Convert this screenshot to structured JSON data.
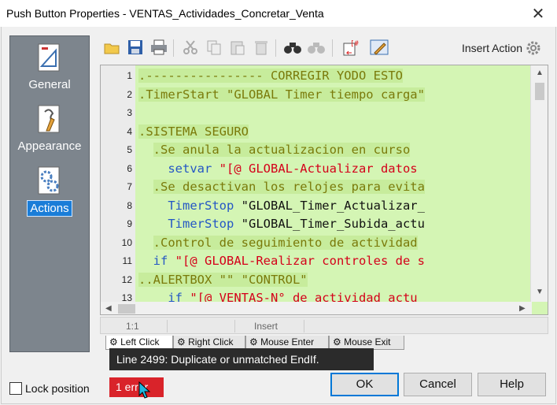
{
  "window": {
    "title": "Push Button Properties - VENTAS_Actividades_Concretar_Venta",
    "close_glyph": "✕"
  },
  "sidebar": {
    "items": [
      {
        "label": "General",
        "icon": "general-icon",
        "active": false
      },
      {
        "label": "Appearance",
        "icon": "appearance-icon",
        "active": false
      },
      {
        "label": "Actions",
        "icon": "actions-icon",
        "active": true
      }
    ]
  },
  "toolbar": {
    "buttons": [
      "new-icon",
      "save-icon",
      "print-icon",
      "cut-icon",
      "copy-icon",
      "paste-icon",
      "delete-icon",
      "find-icon",
      "replace-icon",
      "insert-variable-icon",
      "edit-icon"
    ],
    "insert_action_label": "Insert Action"
  },
  "editor": {
    "lines": [
      {
        "num": "1",
        "indent": "",
        "parts": [
          {
            "t": ".---------------- CORREGIR YODO ESTO",
            "c": "olive"
          }
        ]
      },
      {
        "num": "2",
        "indent": "",
        "parts": [
          {
            "t": ".TimerStart \"GLOBAL Timer tiempo carga\"",
            "c": "olive"
          }
        ]
      },
      {
        "num": "3",
        "indent": "",
        "parts": []
      },
      {
        "num": "4",
        "indent": "",
        "parts": [
          {
            "t": ".SISTEMA SEGURO",
            "c": "olive"
          }
        ]
      },
      {
        "num": "5",
        "indent": "  ",
        "parts": [
          {
            "t": ".Se anula la actualizacion en curso",
            "c": "olive"
          }
        ]
      },
      {
        "num": "6",
        "indent": "    ",
        "parts": [
          {
            "t": "setvar",
            "c": "blue"
          },
          {
            "t": " \"[@ GLOBAL-Actualizar datos",
            "c": "red"
          }
        ]
      },
      {
        "num": "7",
        "indent": "  ",
        "parts": [
          {
            "t": ".Se desactivan los relojes para evita",
            "c": "olive"
          }
        ]
      },
      {
        "num": "8",
        "indent": "    ",
        "parts": [
          {
            "t": "TimerStop",
            "c": "blue"
          },
          {
            "t": " \"GLOBAL_Timer_Actualizar_",
            "c": "black"
          }
        ]
      },
      {
        "num": "9",
        "indent": "    ",
        "parts": [
          {
            "t": "TimerStop",
            "c": "blue"
          },
          {
            "t": " \"GLOBAL_Timer_Subida_actu",
            "c": "black"
          }
        ]
      },
      {
        "num": "10",
        "indent": "  ",
        "parts": [
          {
            "t": ".Control de seguimiento de actividad",
            "c": "olive"
          }
        ]
      },
      {
        "num": "11",
        "indent": "  ",
        "parts": [
          {
            "t": "if",
            "c": "blue"
          },
          {
            "t": " \"[@ GLOBAL-Realizar controles de s",
            "c": "red"
          }
        ]
      },
      {
        "num": "12",
        "indent": "",
        "parts": [
          {
            "t": "..ALERTBOX \"\" \"CONTROL\"",
            "c": "olive"
          }
        ]
      },
      {
        "num": "13",
        "indent": "    ",
        "parts": [
          {
            "t": "if",
            "c": "blue"
          },
          {
            "t": " \"[@ VENTAS-N° de actividad actu",
            "c": "red"
          }
        ]
      }
    ]
  },
  "status": {
    "position": "1:1",
    "mode": "Insert"
  },
  "tabs": [
    "Left Click",
    "Right Click",
    "Mouse Enter",
    "Mouse Exit"
  ],
  "tooltip": "Line 2499: Duplicate or unmatched EndIf.",
  "lock_position_label": "Lock position",
  "error_badge": "1 error",
  "buttons": {
    "ok": "OK",
    "cancel": "Cancel",
    "help": "Help"
  },
  "colors": {
    "editor_bg": "#d4f5b4",
    "keyword": "#2457c5",
    "comment": "#7a7a0a",
    "string": "#d4001a",
    "error": "#d9232a",
    "sidebar": "#7d858d",
    "active": "#1a7dd8"
  }
}
